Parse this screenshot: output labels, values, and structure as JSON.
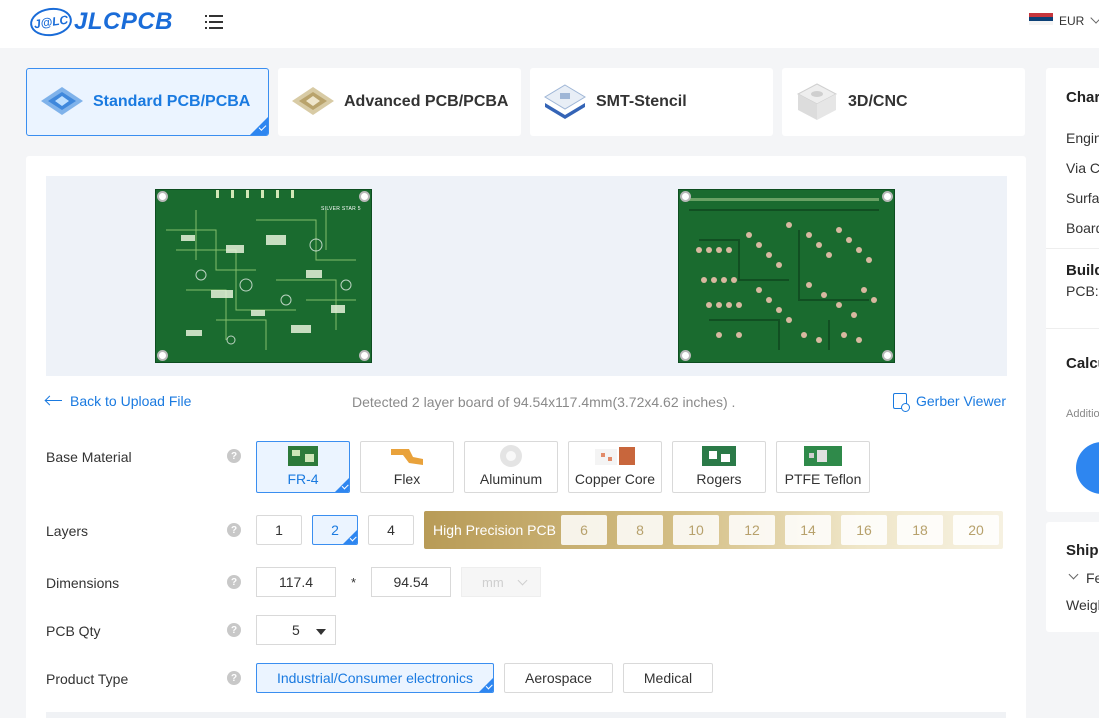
{
  "header": {
    "brand_badge": "J@LC",
    "brand": "JLCPCB",
    "menu_icon": "hamburger-menu-icon",
    "currency": "EUR"
  },
  "tabs": [
    {
      "label": "Standard PCB/PCBA",
      "icon": "standard-pcb-icon",
      "active": true
    },
    {
      "label": "Advanced PCB/PCBA",
      "icon": "advanced-pcb-icon",
      "active": false
    },
    {
      "label": "SMT-Stencil",
      "icon": "smt-stencil-icon",
      "active": false
    },
    {
      "label": "3D/CNC",
      "icon": "3d-cnc-icon",
      "active": false
    }
  ],
  "preview": {
    "silkscreen_text": "SILVER STAR 5",
    "back_link": "Back to Upload File",
    "detected": "Detected 2 layer board of 94.54x117.4mm(3.72x4.62 inches) .",
    "gerber_viewer": "Gerber Viewer"
  },
  "base_material": {
    "label": "Base Material",
    "options": [
      "FR-4",
      "Flex",
      "Aluminum",
      "Copper Core",
      "Rogers",
      "PTFE Teflon"
    ],
    "selected": "FR-4"
  },
  "layers": {
    "label": "Layers",
    "options": [
      "1",
      "2",
      "4"
    ],
    "selected": "2",
    "high_precision_label": "High Precision PCB",
    "high_precision_options": [
      "6",
      "8",
      "10",
      "12",
      "14",
      "16",
      "18",
      "20"
    ]
  },
  "dimensions": {
    "label": "Dimensions",
    "width": "117.4",
    "separator": "*",
    "height": "94.54",
    "unit": "mm"
  },
  "pcb_qty": {
    "label": "PCB Qty",
    "value": "5"
  },
  "product_type": {
    "label": "Product Type",
    "options": [
      "Industrial/Consumer electronics",
      "Aerospace",
      "Medical"
    ],
    "selected": "Industrial/Consumer electronics"
  },
  "help_symbol": "?",
  "side": {
    "charges_title": "Char",
    "charges_items": [
      "Engin",
      "Via C",
      "Surfa",
      "Board"
    ],
    "build_title": "Build",
    "build_text": "PCB:",
    "calc_title": "Calcu",
    "calc_small": "Additio",
    "shipping_title": "Shipp",
    "shipping_item": "Fe",
    "shipping_weight": "Weigh"
  },
  "colors": {
    "brand_blue": "#1a6cd8",
    "accent_blue": "#2e86f0",
    "pcb_green": "#1a6b2f",
    "gold": "#b89b57"
  }
}
